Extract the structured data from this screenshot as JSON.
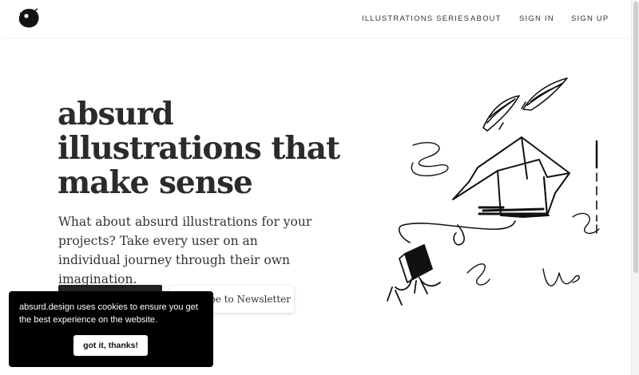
{
  "header": {
    "logo_icon": "ink-blob-logo-icon",
    "nav": [
      {
        "label": "ILLUSTRATIONS SERIES"
      },
      {
        "label": "ABOUT"
      },
      {
        "label": "SIGN IN"
      },
      {
        "label": "SIGN UP"
      }
    ]
  },
  "hero": {
    "headline_lines": [
      "absurd",
      "illustrations that",
      "make sense"
    ],
    "subtitle": "What about absurd illustrations for your projects? Take every user on an individual journey through their own imagination.",
    "primary_button_label": "",
    "newsletter_button_label": "Subscribe to Newsletter",
    "illustration_icon": "flying-box-house-illustration"
  },
  "cookie_banner": {
    "text": "absurd.design uses cookies to ensure you get the best experience on the website.",
    "button_label": "got it, thanks!"
  },
  "colors": {
    "background": "#ffffff",
    "text": "#2b2b2b",
    "dark_button": "#222222",
    "cookie_background": "#000000"
  }
}
